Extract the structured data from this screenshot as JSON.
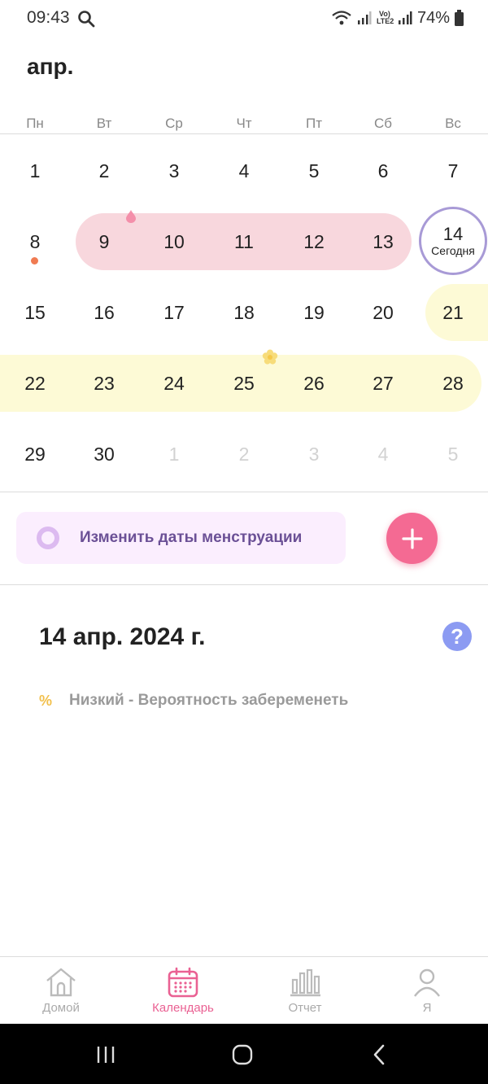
{
  "status_bar": {
    "time": "09:43",
    "battery": "74%",
    "network_label": "Vo) LTE2"
  },
  "calendar": {
    "month": "апр.",
    "weekdays": [
      "Пн",
      "Вт",
      "Ср",
      "Чт",
      "Пт",
      "Сб",
      "Вс"
    ],
    "today_label": "Сегодня",
    "weeks": [
      [
        "1",
        "2",
        "3",
        "4",
        "5",
        "6",
        "7"
      ],
      [
        "8",
        "9",
        "10",
        "11",
        "12",
        "13",
        "14"
      ],
      [
        "15",
        "16",
        "17",
        "18",
        "19",
        "20",
        "21"
      ],
      [
        "22",
        "23",
        "24",
        "25",
        "26",
        "27",
        "28"
      ],
      [
        "29",
        "30",
        "1",
        "2",
        "3",
        "4",
        "5"
      ]
    ]
  },
  "actions": {
    "edit_period_label": "Изменить даты менструации",
    "add_icon": "plus-icon"
  },
  "details": {
    "date_title": "14 апр. 2024 г.",
    "help_symbol": "?",
    "percent_symbol": "%",
    "probability_text": "Низкий - Вероятность забеременеть"
  },
  "nav": {
    "items": [
      {
        "label": "Домой",
        "icon": "home-icon"
      },
      {
        "label": "Календарь",
        "icon": "calendar-icon"
      },
      {
        "label": "Отчет",
        "icon": "bar-chart-icon"
      },
      {
        "label": "Я",
        "icon": "profile-icon"
      }
    ]
  },
  "colors": {
    "menstruation": "#f8d7dd",
    "fertile": "#fdfad6",
    "accent": "#f46a93",
    "today_ring": "#a89ad6",
    "nav_active": "#ea6193"
  }
}
